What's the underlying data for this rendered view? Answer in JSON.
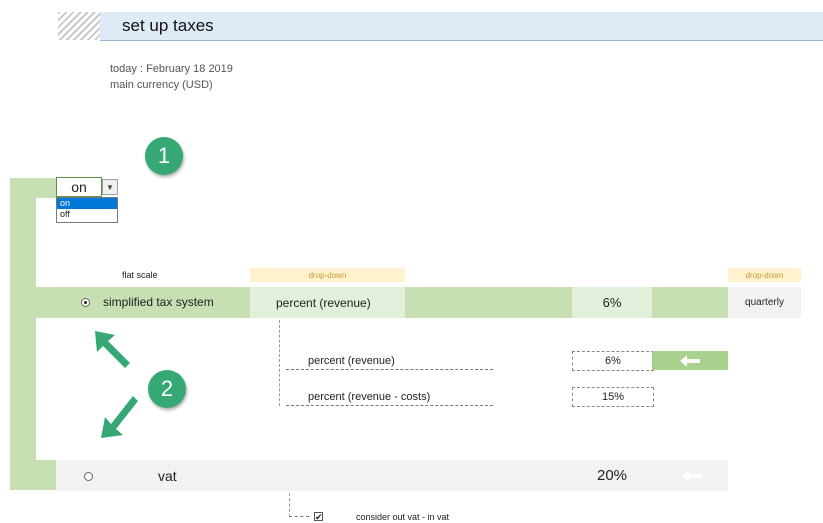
{
  "header": {
    "title": "set up taxes"
  },
  "info": {
    "today": "today : February 18 2019",
    "currency": "main currency (USD)"
  },
  "badges": {
    "step1": "1",
    "step2": "2"
  },
  "switch": {
    "value": "on",
    "options": [
      "on",
      "off"
    ],
    "selected": "on"
  },
  "labels": {
    "flat_scale": "flat scale",
    "dropdown_tag_1": "drop-down",
    "dropdown_tag_2": "drop-down"
  },
  "simplified": {
    "name": "simplified tax system",
    "method": "percent (revenue)",
    "rate": "6%",
    "period": "quarterly",
    "selected": true
  },
  "options": [
    {
      "label": "percent (revenue)",
      "value": "6%"
    },
    {
      "label": "percent (revenue - costs)",
      "value": "15%"
    }
  ],
  "vat": {
    "name": "vat",
    "rate": "20%",
    "selected": false
  },
  "vat_option": {
    "label": "consider out vat - in vat",
    "checked": true,
    "check_mark": "✔"
  },
  "colors": {
    "accent_green": "#c6e0b4",
    "light_green": "#e2efda",
    "badge_green": "#35a876",
    "title_blue": "#ddebf7",
    "dropdown_tag": "#fff2cc"
  }
}
